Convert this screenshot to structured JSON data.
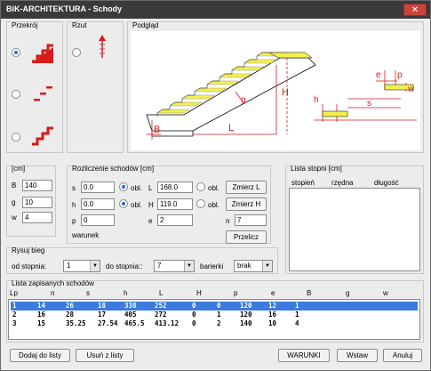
{
  "window": {
    "title": "BiK-ARCHITEKTURA - Schody",
    "close_glyph": "✕"
  },
  "przekroj": {
    "label": "Przekrój",
    "selected": 0
  },
  "rzut": {
    "label": "Rzut"
  },
  "podglad": {
    "label": "Podgląd",
    "diagram_labels": [
      "H",
      "L",
      "B",
      "g",
      "h",
      "s",
      "e",
      "p",
      "w"
    ]
  },
  "units_group": {
    "label": "[cm]",
    "fields": [
      {
        "label": "B",
        "value": "140"
      },
      {
        "label": "g",
        "value": "10"
      },
      {
        "label": "w",
        "value": "4"
      }
    ]
  },
  "calc_group": {
    "label": "Rozliczenie schodów [cm]",
    "s": {
      "label": "s",
      "value": "0.0"
    },
    "h": {
      "label": "h",
      "value": "0.0"
    },
    "p": {
      "label": "p",
      "value": "0"
    },
    "obl1": "obl.",
    "obl2": "obl.",
    "L": {
      "label": "L",
      "value": "168.0"
    },
    "H": {
      "label": "H",
      "value": "119.0"
    },
    "e": {
      "label": "e",
      "value": "2"
    },
    "obl3": "obl.",
    "obl4": "obl.",
    "n": {
      "label": "n",
      "value": "7"
    },
    "measure_L": "Zmierz L",
    "measure_H": "Zmierz H",
    "recalc": "Przelicz",
    "warunek": "warunek"
  },
  "steps_list": {
    "label": "Lista stopni [cm]",
    "columns": [
      "stopień",
      "rzędna",
      "długość"
    ]
  },
  "rysuj": {
    "label": "Rysuj bieg",
    "from_label": "od stopnia:",
    "from_value": "1",
    "to_label": "do stopnia::",
    "to_value": "7",
    "barierki_label": "barierki",
    "barierki_value": "brak"
  },
  "saved": {
    "label": "Lista zapisanych schodów",
    "columns": [
      "Lp",
      "n",
      "s",
      "h",
      "L",
      "H",
      "p",
      "e",
      "B",
      "g",
      "w"
    ],
    "rows": [
      [
        "1",
        "14",
        "26",
        "18",
        "338",
        "252",
        "0",
        "0",
        "120",
        "12",
        "1"
      ],
      [
        "2",
        "16",
        "28",
        "17",
        "405",
        "272",
        "0",
        "1",
        "120",
        "16",
        "1"
      ],
      [
        "3",
        "15",
        "35.25",
        "27.54",
        "465.5",
        "413.12",
        "0",
        "2",
        "140",
        "10",
        "4"
      ]
    ],
    "selected_row": 0
  },
  "buttons": {
    "add": "Dodaj do listy",
    "remove": "Usuń z listy",
    "warunki": "WARUNKI",
    "insert": "Wstaw",
    "cancel": "Anuluj"
  }
}
